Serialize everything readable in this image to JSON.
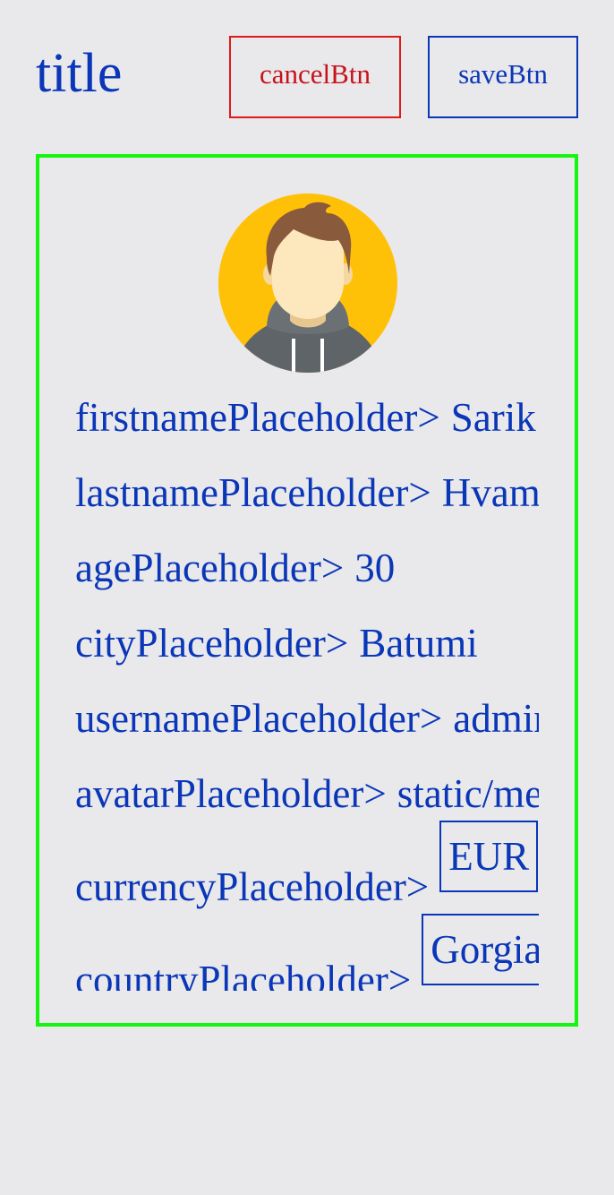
{
  "header": {
    "title": "title",
    "cancel_label": "cancelBtn",
    "save_label": "saveBtn"
  },
  "colors": {
    "text": "#0a36b8",
    "cancel_border": "#e01a1a",
    "card_border": "#16f50f",
    "background": "#e9e8eb",
    "avatar_bg": "#ffc107"
  },
  "avatar": {
    "icon": "user-avatar-icon"
  },
  "form": {
    "firstname": {
      "label": "firstnamePlaceholder>",
      "value": "Sarik"
    },
    "lastname": {
      "label": "lastnamePlaceholder>",
      "value": "Hvamazov"
    },
    "age": {
      "label": "agePlaceholder>",
      "value": "30"
    },
    "city": {
      "label": "cityPlaceholder>",
      "value": "Batumi"
    },
    "username": {
      "label": "usernamePlaceholder>",
      "value": "admin"
    },
    "avatar": {
      "label": "avatarPlaceholder>",
      "value": "static/media/avatar.png"
    },
    "currency": {
      "label": "currencyPlaceholder>",
      "value": "EUR"
    },
    "country": {
      "label": "countryPlaceholder>",
      "value": "Gorgia"
    }
  }
}
